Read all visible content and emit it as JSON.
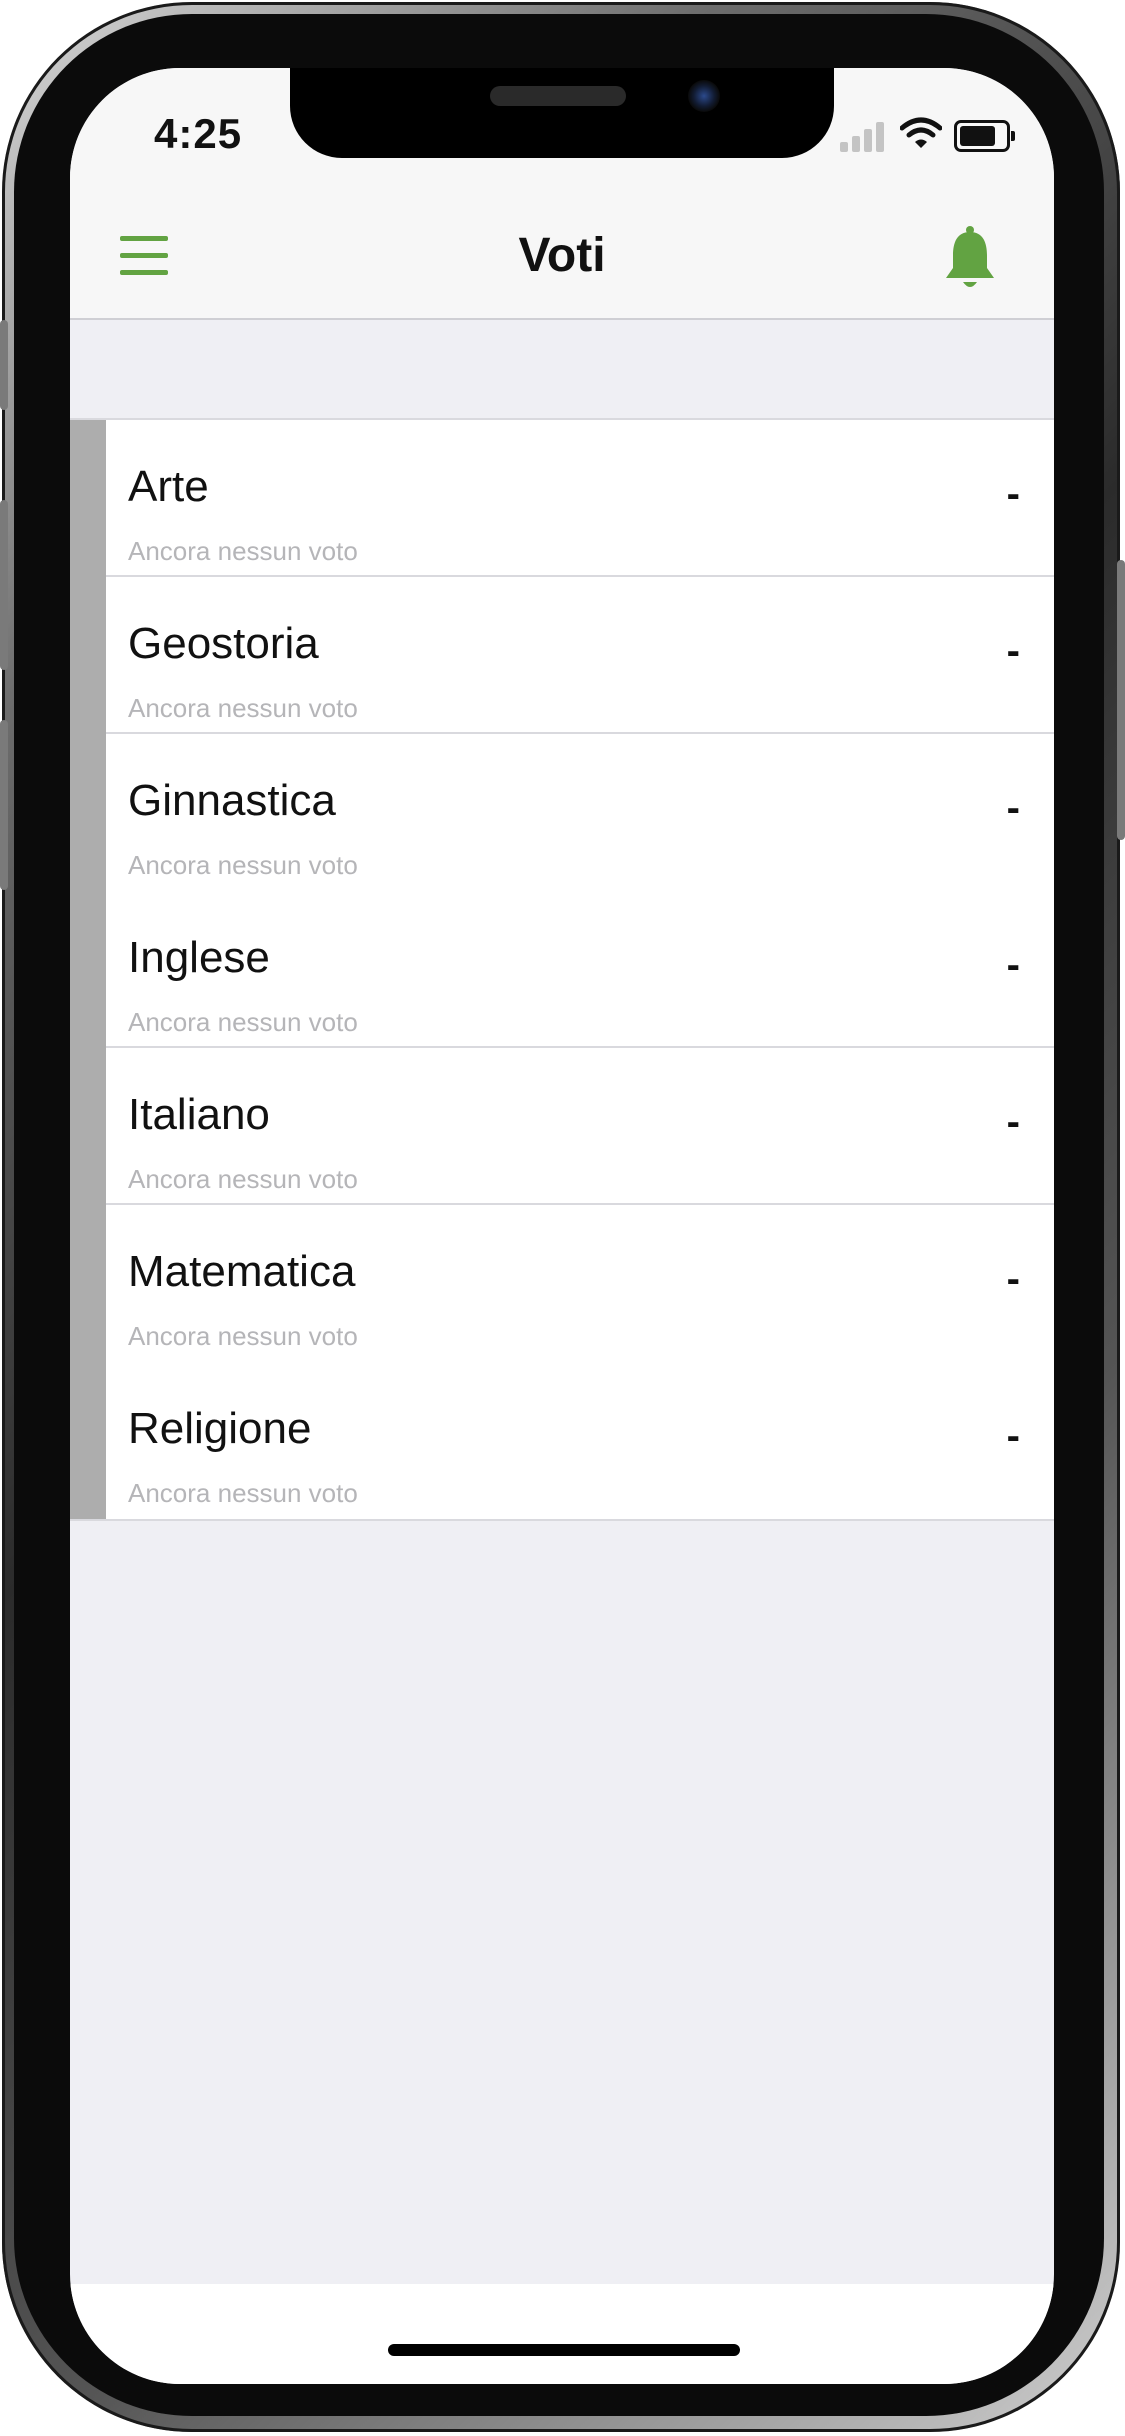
{
  "status_bar": {
    "time": "4:25",
    "signal_icon": "cellular-signal-icon",
    "wifi_icon": "wifi-icon",
    "battery_icon": "battery-icon",
    "battery_level": 0.7
  },
  "nav": {
    "title": "Voti",
    "menu_icon": "hamburger-menu-icon",
    "bell_icon": "bell-icon",
    "accent_color": "#62a342"
  },
  "subjects": [
    {
      "name": "Arte",
      "subtitle": "Ancora nessun voto",
      "grade": "-"
    },
    {
      "name": "Geostoria",
      "subtitle": "Ancora nessun voto",
      "grade": "-"
    },
    {
      "name": "Ginnastica",
      "subtitle": "Ancora nessun voto",
      "grade": "-"
    },
    {
      "name": "Inglese",
      "subtitle": "Ancora nessun voto",
      "grade": "-"
    },
    {
      "name": "Italiano",
      "subtitle": "Ancora nessun voto",
      "grade": "-"
    },
    {
      "name": "Matematica",
      "subtitle": "Ancora nessun voto",
      "grade": "-"
    },
    {
      "name": "Religione",
      "subtitle": "Ancora nessun voto",
      "grade": "-"
    }
  ]
}
